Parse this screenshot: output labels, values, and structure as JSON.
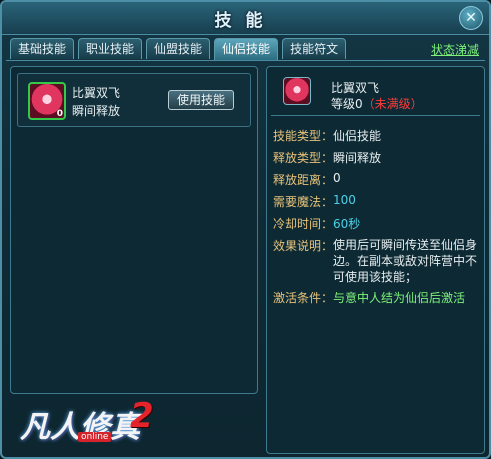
{
  "window": {
    "title": "技能",
    "close_glyph": "✕"
  },
  "tabs": [
    {
      "label": "基础技能",
      "active": false
    },
    {
      "label": "职业技能",
      "active": false
    },
    {
      "label": "仙盟技能",
      "active": false
    },
    {
      "label": "仙侣技能",
      "active": true
    },
    {
      "label": "技能符文",
      "active": false
    }
  ],
  "status_link": "状态涕减",
  "skill_list": [
    {
      "name": "比翼双飞",
      "cast": "瞬间释放",
      "level_badge": "0",
      "button": "使用技能",
      "icon": "pink-phoenix-skill-icon"
    }
  ],
  "detail": {
    "name": "比翼双飞",
    "level_label": "等级0",
    "level_status": "（未满级）",
    "rows": {
      "skill_type": {
        "label": "技能类型：",
        "value": "仙侣技能"
      },
      "release_type": {
        "label": "释放类型：",
        "value": "瞬间释放"
      },
      "range": {
        "label": "释放距离：",
        "value": "0"
      },
      "mana": {
        "label": "需要魔法：",
        "value": "100"
      },
      "cooldown": {
        "label": "冷却时间：",
        "value": "60秒"
      },
      "effect": {
        "label": "效果说明：",
        "value": "使用后可瞬间传送至仙侣身边。在副本或敌对阵营中不可使用该技能；"
      },
      "activate": {
        "label": "激活条件：",
        "value": "与意中人结为仙侣后激活"
      }
    }
  },
  "logo": {
    "text": "凡人修真",
    "number": "2",
    "tag": "online"
  },
  "colors": {
    "accent_green": "#7ef27a",
    "accent_red": "#ff3a3a",
    "value_cyan": "#4fd0e8",
    "label_gold": "#e8c27a"
  }
}
